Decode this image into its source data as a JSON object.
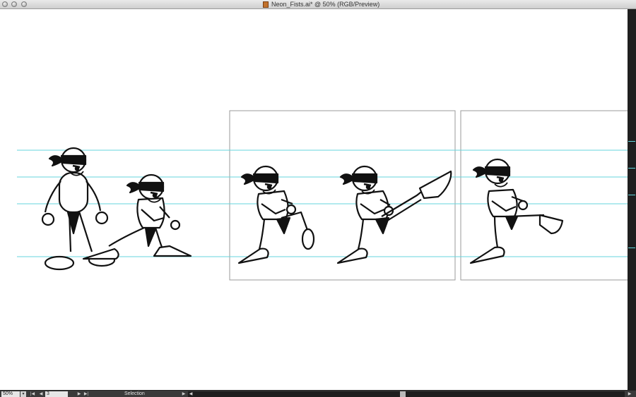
{
  "window": {
    "title": "Neon_Fists.ai* @ 50% (RGB/Preview)",
    "controls": [
      "close-icon",
      "minimize-icon",
      "zoom-icon"
    ]
  },
  "canvas": {
    "guide_color": "#64d6dc",
    "artboard_border_color": "#9a9a9a",
    "ink_color": "#111111",
    "figures": [
      "ninja-front-stance",
      "ninja-side-stance",
      "ninja-ready-pose",
      "ninja-high-kick",
      "ninja-knee-strike"
    ]
  },
  "statusbar": {
    "zoom": "50%",
    "artboard_number": "3",
    "tool": "Selection",
    "icons": [
      "first-artboard-icon",
      "previous-artboard-icon",
      "next-artboard-icon",
      "last-artboard-icon",
      "status-menu-icon",
      "scroll-left-icon",
      "scroll-right-icon"
    ]
  }
}
